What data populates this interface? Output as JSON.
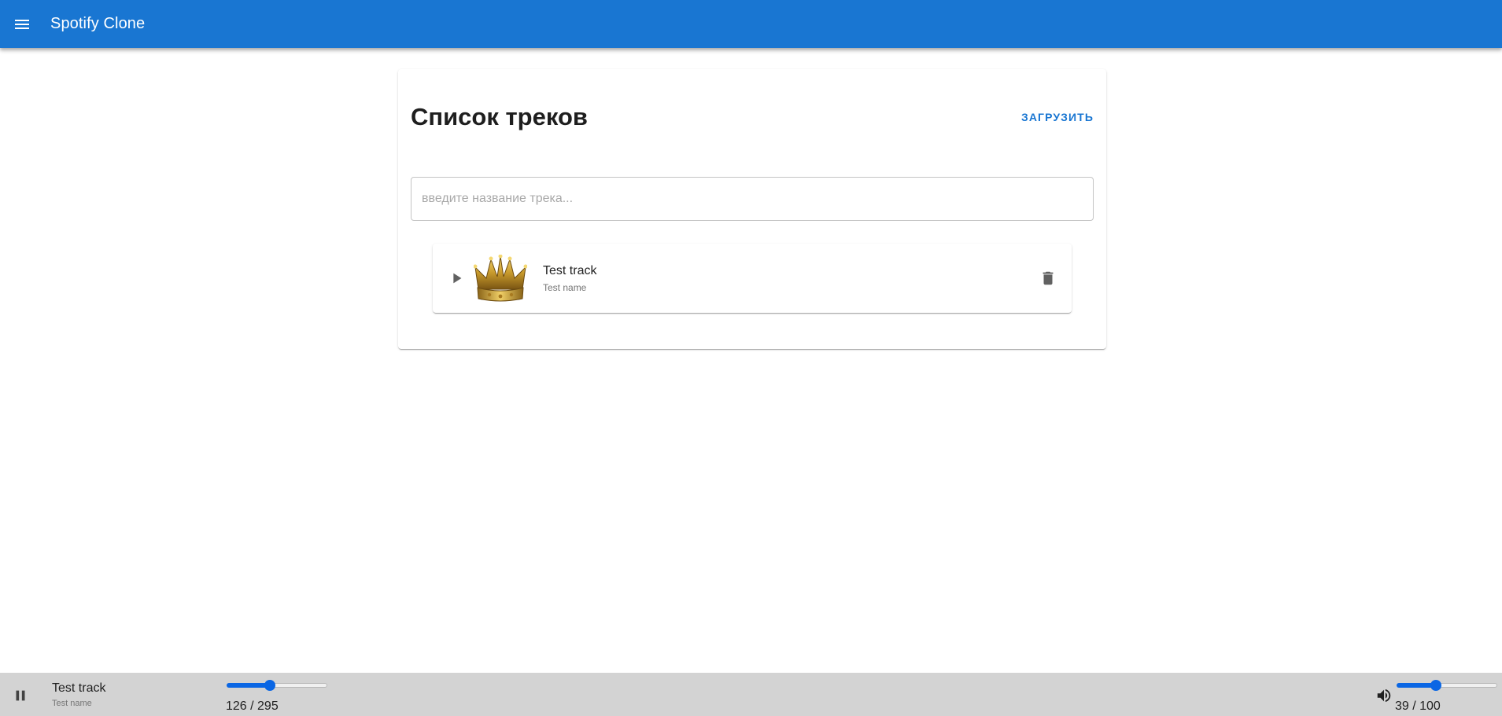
{
  "appbar": {
    "title": "Spotify Clone",
    "menu_icon": "menu-icon",
    "color": "#1976d2"
  },
  "tracks_page": {
    "title": "Список треков",
    "upload_label": "Загрузить",
    "search": {
      "placeholder": "введите название трека...",
      "value": ""
    },
    "tracks": [
      {
        "name": "Test track",
        "artist": "Test name",
        "play_icon": "play-icon",
        "cover_icon": "crown-icon",
        "delete_icon": "trash-icon"
      }
    ]
  },
  "player": {
    "track_name": "Test track",
    "artist": "Test name",
    "pause_icon": "pause-icon",
    "volume_icon": "volume-up-icon",
    "current_time": 126,
    "duration": 295,
    "progress_label": "126 / 295",
    "volume": 39,
    "volume_max": 100,
    "volume_label": "39 / 100",
    "slider_color": "#0a66e4",
    "bar_color": "#d3d3d3"
  }
}
